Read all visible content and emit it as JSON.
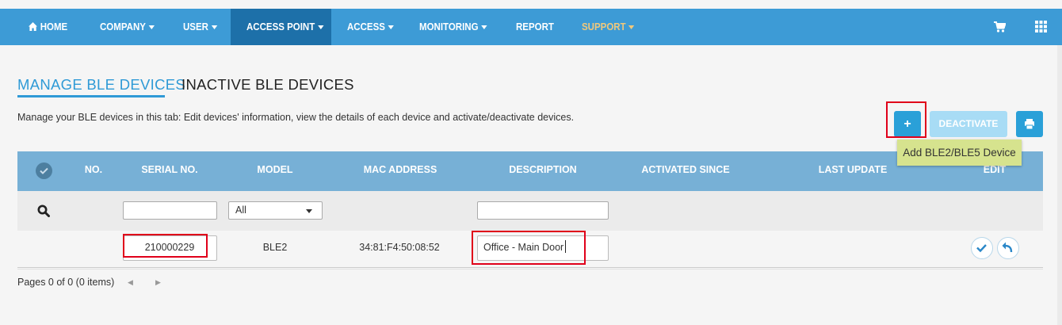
{
  "navbar": {
    "items": [
      {
        "label": "HOME"
      },
      {
        "label": "COMPANY"
      },
      {
        "label": "USER"
      },
      {
        "label": "ACCESS POINT"
      },
      {
        "label": "ACCESS"
      },
      {
        "label": "MONITORING"
      },
      {
        "label": "REPORT"
      },
      {
        "label": "SUPPORT"
      }
    ],
    "active_item": "ACCESS POINT",
    "icons": [
      "home-icon",
      "cart-icon",
      "apps-grid-icon"
    ],
    "colors": {
      "bar": "#3d9bd6",
      "active": "#1d70a9",
      "support": "#f0c87c"
    }
  },
  "tabs": {
    "active": "MANAGE BLE DEVICES",
    "inactive": "INACTIVE BLE DEVICES"
  },
  "description": "Manage your BLE devices in this tab: Edit devices' information, view the details of each device and activate/deactivate devices.",
  "actions": {
    "add_label": "+",
    "deactivate_label": "DEACTIVATE",
    "tooltip": "Add BLE2/BLE5 Device"
  },
  "table": {
    "columns": [
      "NO.",
      "SERIAL NO.",
      "MODEL",
      "MAC ADDRESS",
      "DESCRIPTION",
      "ACTIVATED SINCE",
      "LAST UPDATE",
      "EDIT"
    ],
    "filters": {
      "serial_value": "",
      "model_selected": "All",
      "description_value": ""
    },
    "rows": [
      {
        "no": "",
        "serial": "210000229",
        "model": "BLE2",
        "mac": "34:81:F4:50:08:52",
        "description": "Office - Main Door",
        "activated_since": "",
        "last_update": ""
      }
    ]
  },
  "pager": {
    "text": "Pages 0 of 0 (0 items)",
    "prev": "◀",
    "next": "▶"
  }
}
